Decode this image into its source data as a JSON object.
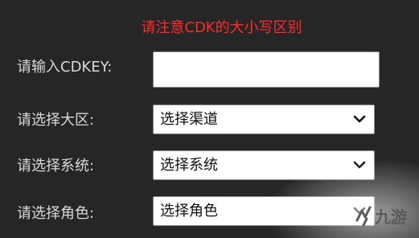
{
  "notice": "请注意CDK的大小写区别",
  "form": {
    "cdkey": {
      "label": "请输入CDKEY:",
      "value": ""
    },
    "region": {
      "label": "请选择大区:",
      "selected": "选择渠道"
    },
    "system": {
      "label": "请选择系统:",
      "selected": "选择系统"
    },
    "role": {
      "label": "请选择角色:",
      "selected": "选择角色"
    }
  },
  "watermark": {
    "text": "九游"
  },
  "colors": {
    "background": "#262626",
    "notice": "#ff2a2a",
    "label": "#d9d9d9",
    "field": "#ffffff"
  },
  "icons": {
    "dropdown": "chevron-down-icon"
  }
}
